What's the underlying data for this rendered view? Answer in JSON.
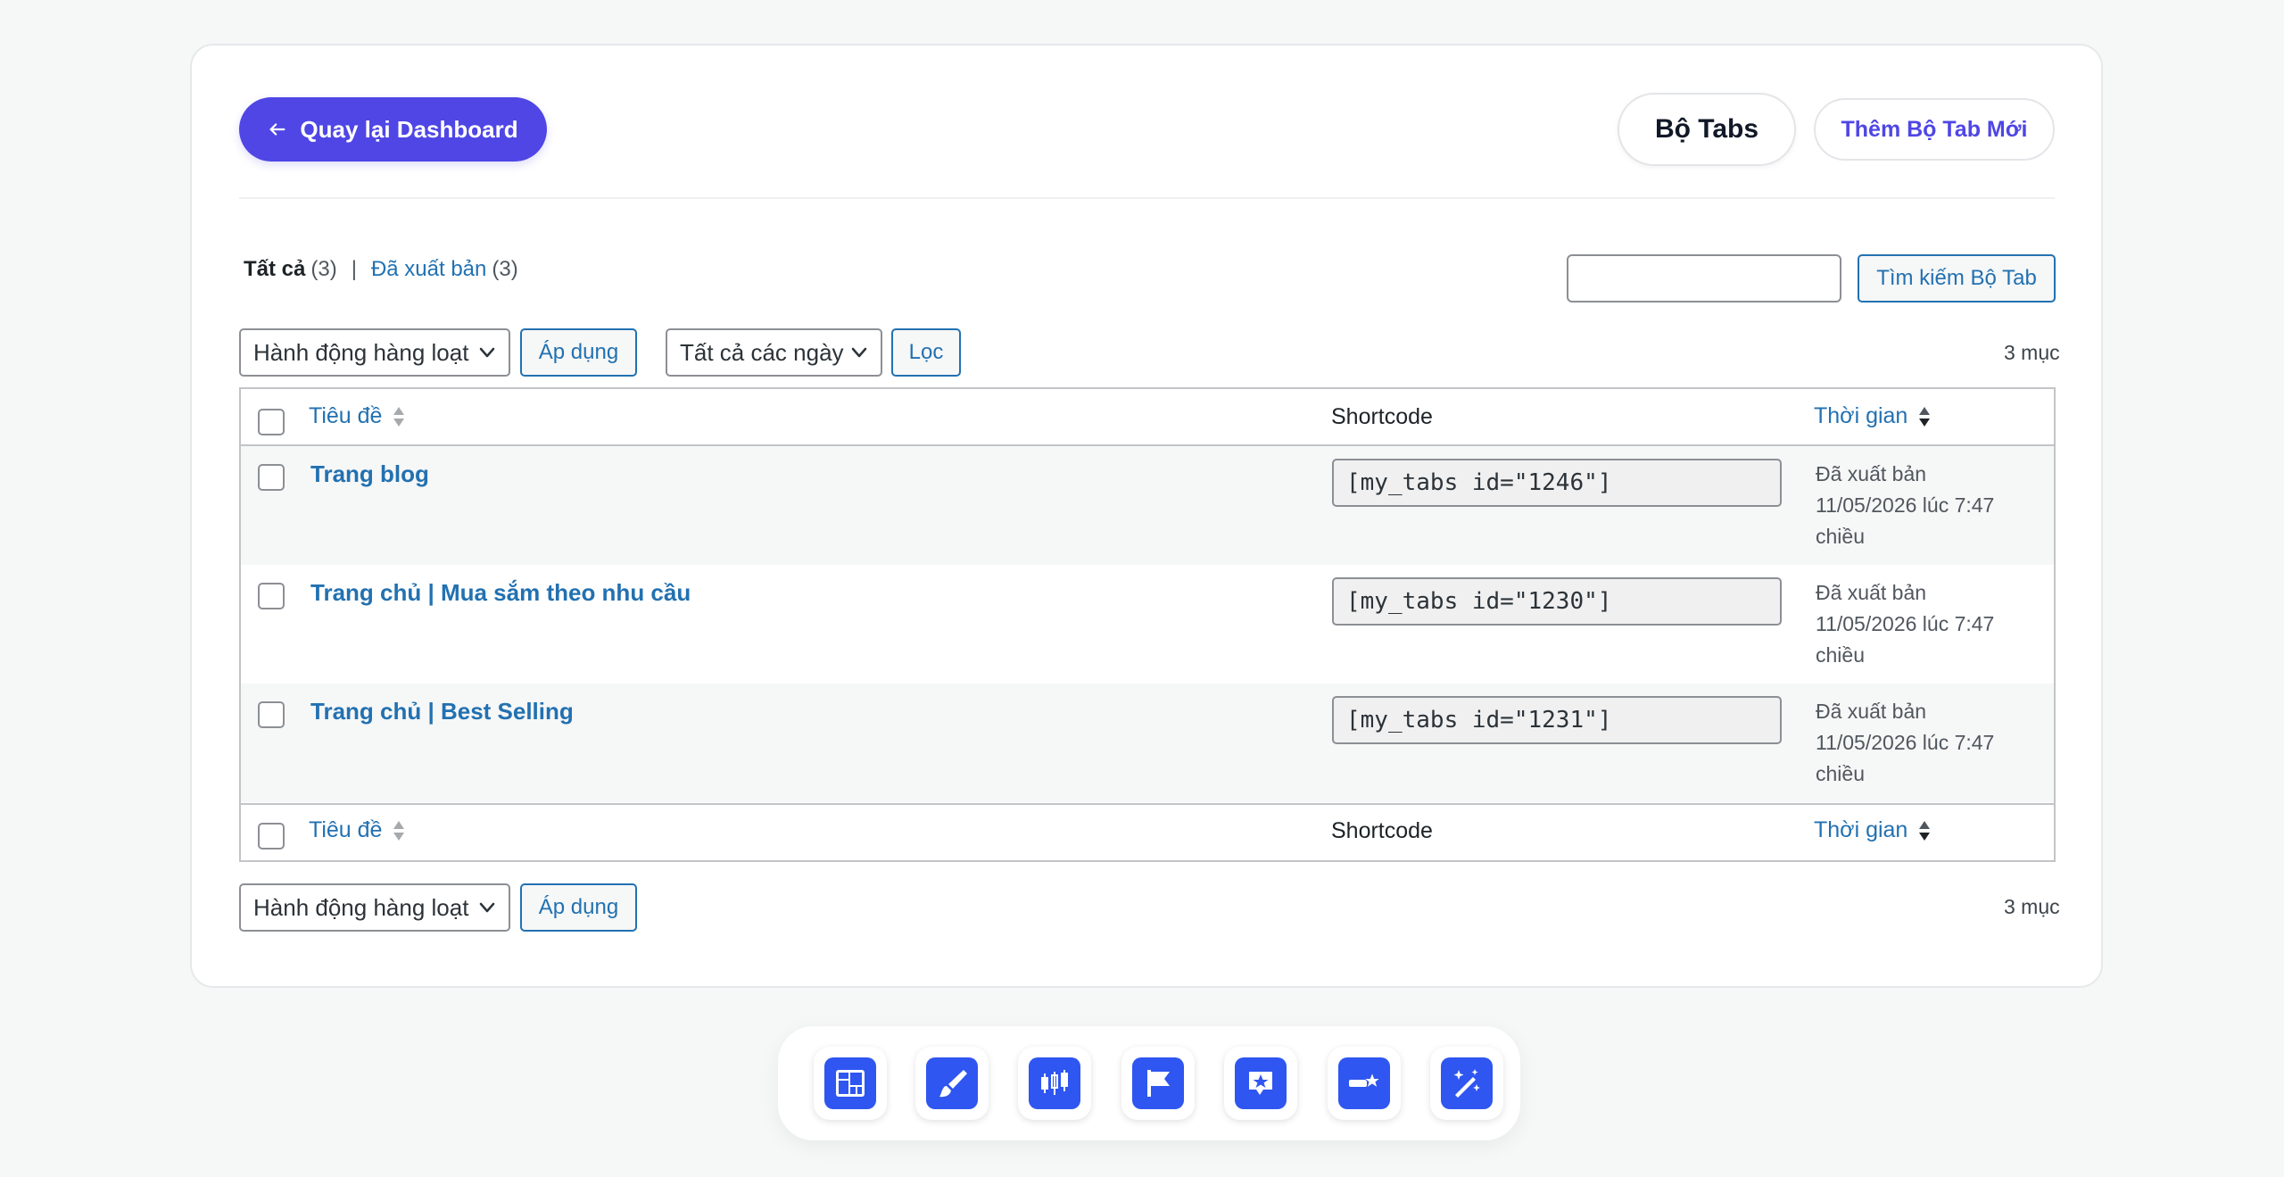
{
  "header": {
    "back_label": "Quay lại Dashboard",
    "page_title": "Bộ Tabs",
    "add_new_label": "Thêm Bộ Tab Mới"
  },
  "filters": {
    "all_label": "Tất cả",
    "all_count": "(3)",
    "separator": "|",
    "published_label": "Đã xuất bản",
    "published_count": "(3)"
  },
  "search": {
    "value": "",
    "button_label": "Tìm kiếm Bộ Tab"
  },
  "tablenav_top": {
    "bulk_action": "Hành động hàng loạt",
    "apply_label": "Áp dụng",
    "date_filter": "Tất cả các ngày",
    "filter_label": "Lọc",
    "items_count": "3 mục"
  },
  "table": {
    "columns": {
      "title": "Tiêu đề",
      "shortcode": "Shortcode",
      "date": "Thời gian"
    },
    "rows": [
      {
        "title": "Trang blog",
        "shortcode": "[my_tabs id=\"1246\"]",
        "status": "Đã xuất bản",
        "date": "11/05/2026 lúc 7:47",
        "date_suffix": "chiều"
      },
      {
        "title": "Trang chủ | Mua sắm theo nhu cầu",
        "shortcode": "[my_tabs id=\"1230\"]",
        "status": "Đã xuất bản",
        "date": "11/05/2026 lúc 7:47",
        "date_suffix": "chiều"
      },
      {
        "title": "Trang chủ | Best Selling",
        "shortcode": "[my_tabs id=\"1231\"]",
        "status": "Đã xuất bản",
        "date": "11/05/2026 lúc 7:47",
        "date_suffix": "chiều"
      }
    ]
  },
  "tablenav_bottom": {
    "bulk_action": "Hành động hàng loạt",
    "apply_label": "Áp dụng",
    "items_count": "3 mục"
  },
  "dock": {
    "accent_color": "#2f56f0",
    "items": [
      {
        "icon": "layout-grid-icon"
      },
      {
        "icon": "paint-brush-icon"
      },
      {
        "icon": "candlestick-chart-icon"
      },
      {
        "icon": "flag-icon"
      },
      {
        "icon": "star-badge-icon"
      },
      {
        "icon": "progress-star-icon"
      },
      {
        "icon": "magic-wand-icon"
      }
    ]
  },
  "colors": {
    "primary": "#4f46e5",
    "link": "#2271b1"
  }
}
